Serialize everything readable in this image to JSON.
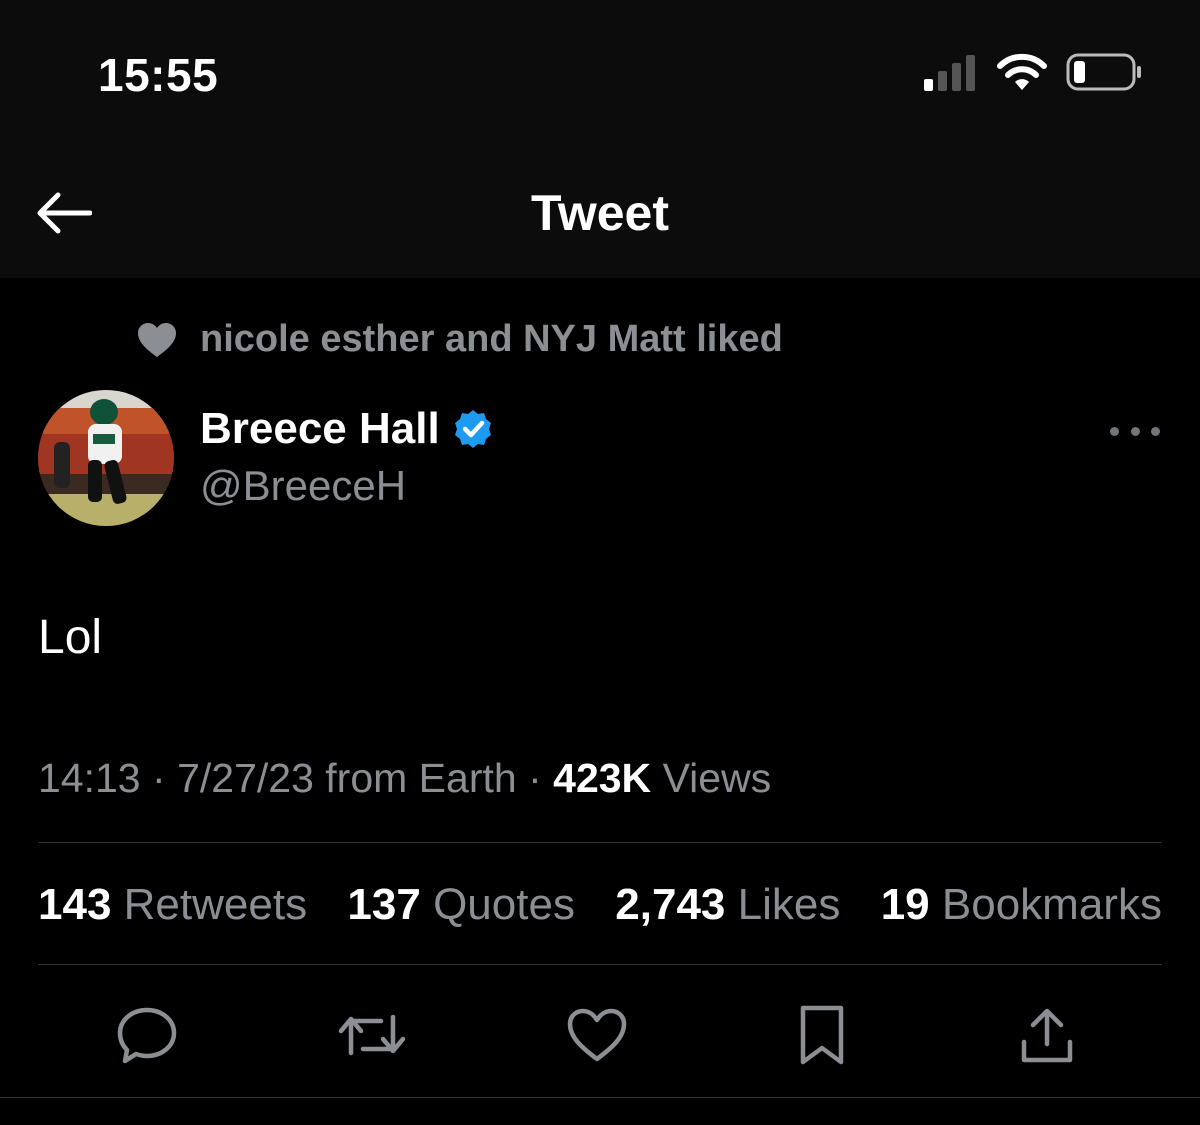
{
  "status_bar": {
    "time": "15:55"
  },
  "nav": {
    "title": "Tweet"
  },
  "social_context": {
    "text": "nicole esther and NYJ Matt liked"
  },
  "author": {
    "name": "Breece Hall",
    "handle": "@BreeceH",
    "verified_color": "#1d9bf0"
  },
  "tweet": {
    "text": "Lol"
  },
  "meta": {
    "time": "14:13",
    "separator": "·",
    "date": "7/27/23",
    "source": "from Earth",
    "views_count": "423K",
    "views_label": "Views"
  },
  "stats": [
    {
      "count": "143",
      "label": "Retweets"
    },
    {
      "count": "137",
      "label": "Quotes"
    },
    {
      "count": "2,743",
      "label": "Likes"
    },
    {
      "count": "19",
      "label": "Bookmarks"
    }
  ],
  "actions": [
    "reply-icon",
    "retweet-icon",
    "like-icon",
    "bookmark-icon",
    "share-icon"
  ],
  "colors": {
    "background": "#000000",
    "header": "#0c0c0c",
    "text": "#e7e9ea",
    "muted": "#8b8f94",
    "accent": "#1d9bf0"
  }
}
